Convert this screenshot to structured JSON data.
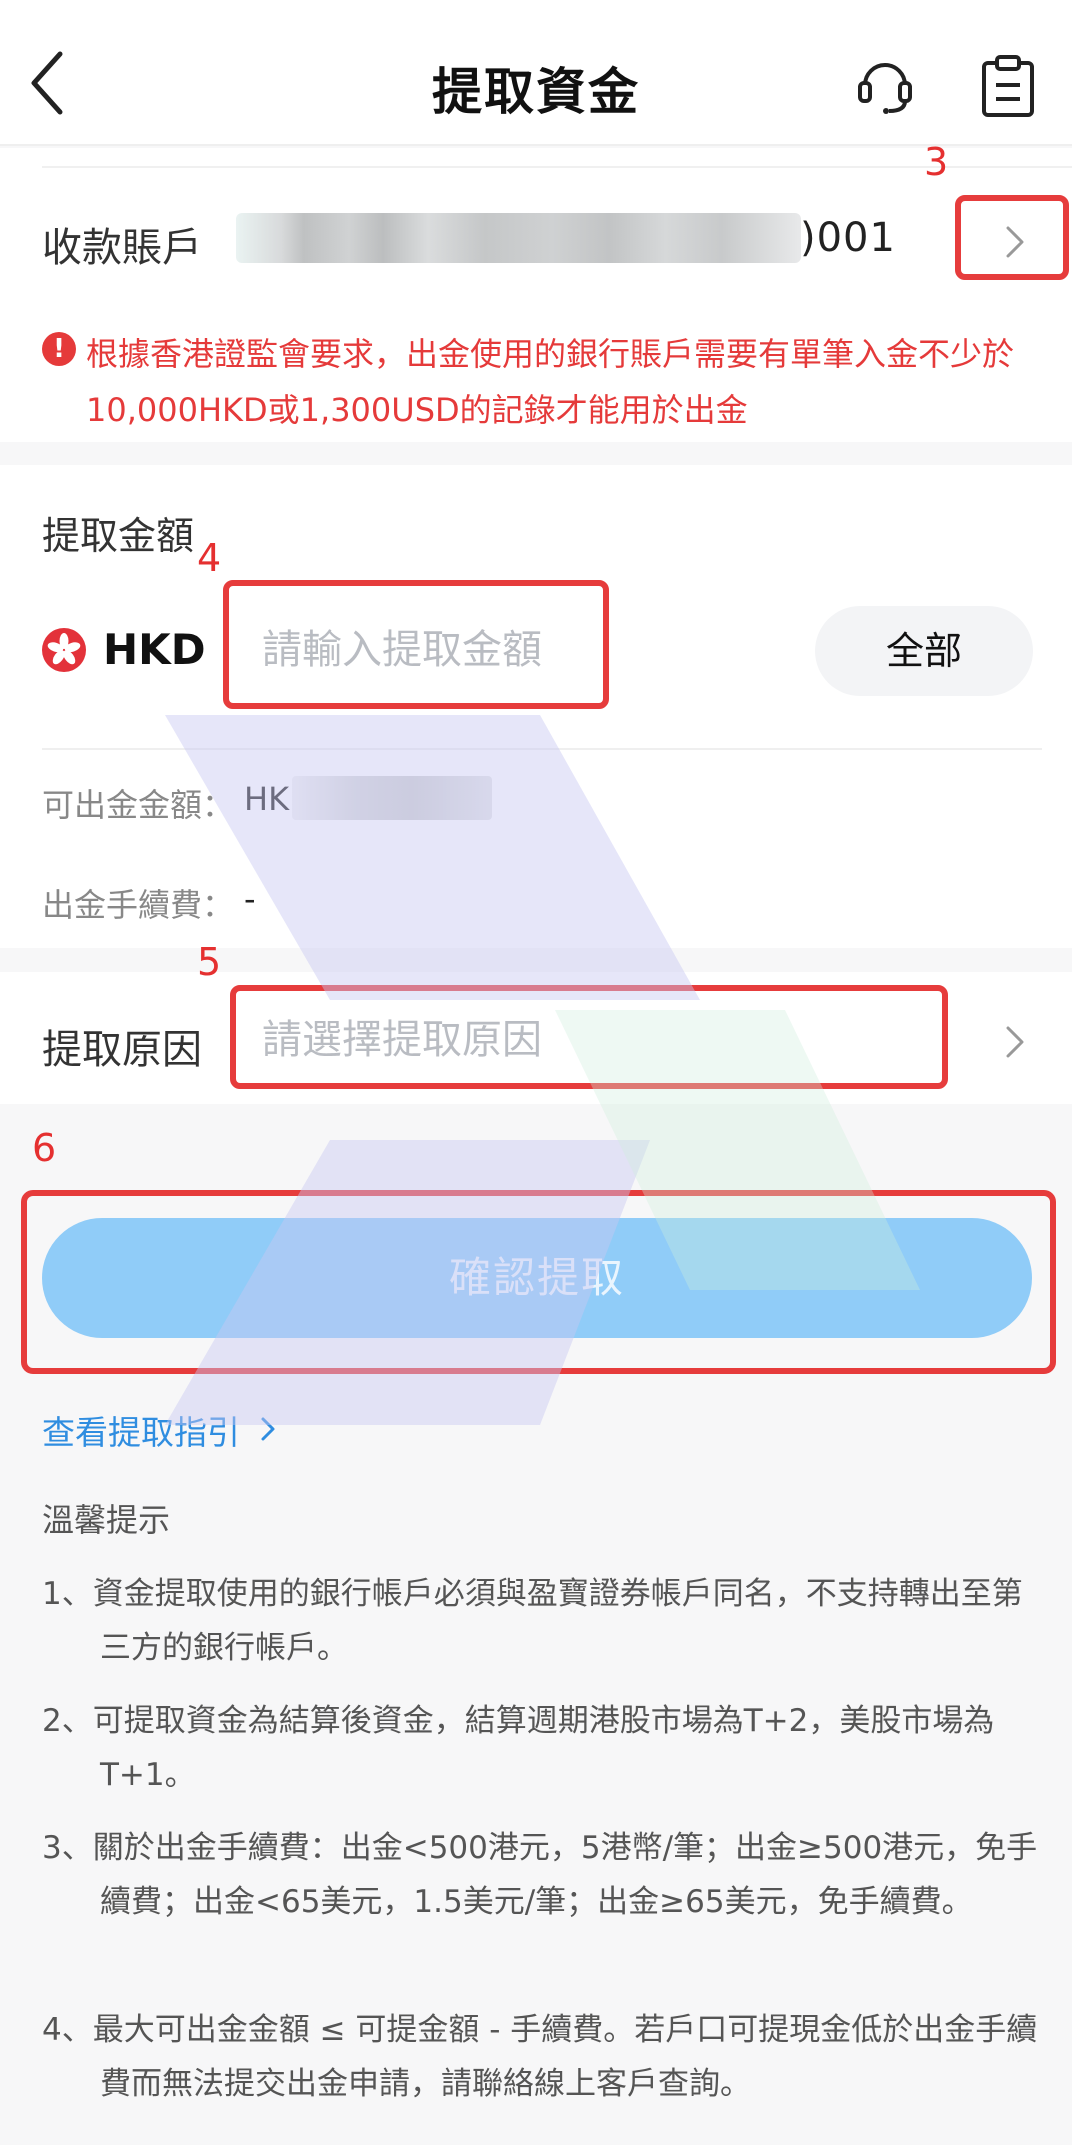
{
  "header": {
    "title": "提取資金"
  },
  "account": {
    "label": "收款賬戶",
    "number_suffix": ")001"
  },
  "warning": {
    "text": "根據香港證監會要求，出金使用的銀行賬戶需要有單筆入金不少於10,000HKD或1,300USD的記錄才能用於出金"
  },
  "amount": {
    "label": "提取金額",
    "currency": "HKD",
    "placeholder": "請輸入提取金額",
    "all_button": "全部",
    "available_label": "可出金金額：",
    "available_value": "HKI",
    "fee_label": "出金手續費：",
    "fee_value": "-"
  },
  "reason": {
    "label": "提取原因",
    "placeholder": "請選擇提取原因"
  },
  "confirm_label": "確認提取",
  "guide_link": "查看提取指引",
  "tips": {
    "title": "溫馨提示",
    "items": [
      "1、資金提取使用的銀行帳戶必須與盈寶證券帳戶同名，不支持轉出至第三方的銀行帳戶。",
      "2、可提取資金為結算後資金，結算週期港股市場為T+2，美股市場為T+1。",
      "3、關於出金手續費：出金<500港元，5港幣/筆；出金≥500港元，免手續費；出金<65美元，1.5美元/筆；出金≥65美元，免手續費。",
      "4、最大可出金金額 ≤ 可提金額 - 手續費。若戶口可提現金低於出金手續費而無法提交出金申請，請聯絡線上客戶查詢。"
    ]
  },
  "annotations": {
    "step3": "3",
    "step4": "4",
    "step5": "5",
    "step6": "6",
    "color": "#e63c3c"
  },
  "colors": {
    "accent": "#2f8de0",
    "confirm_disabled": "#90ccf8",
    "warning": "#e53a3a"
  }
}
